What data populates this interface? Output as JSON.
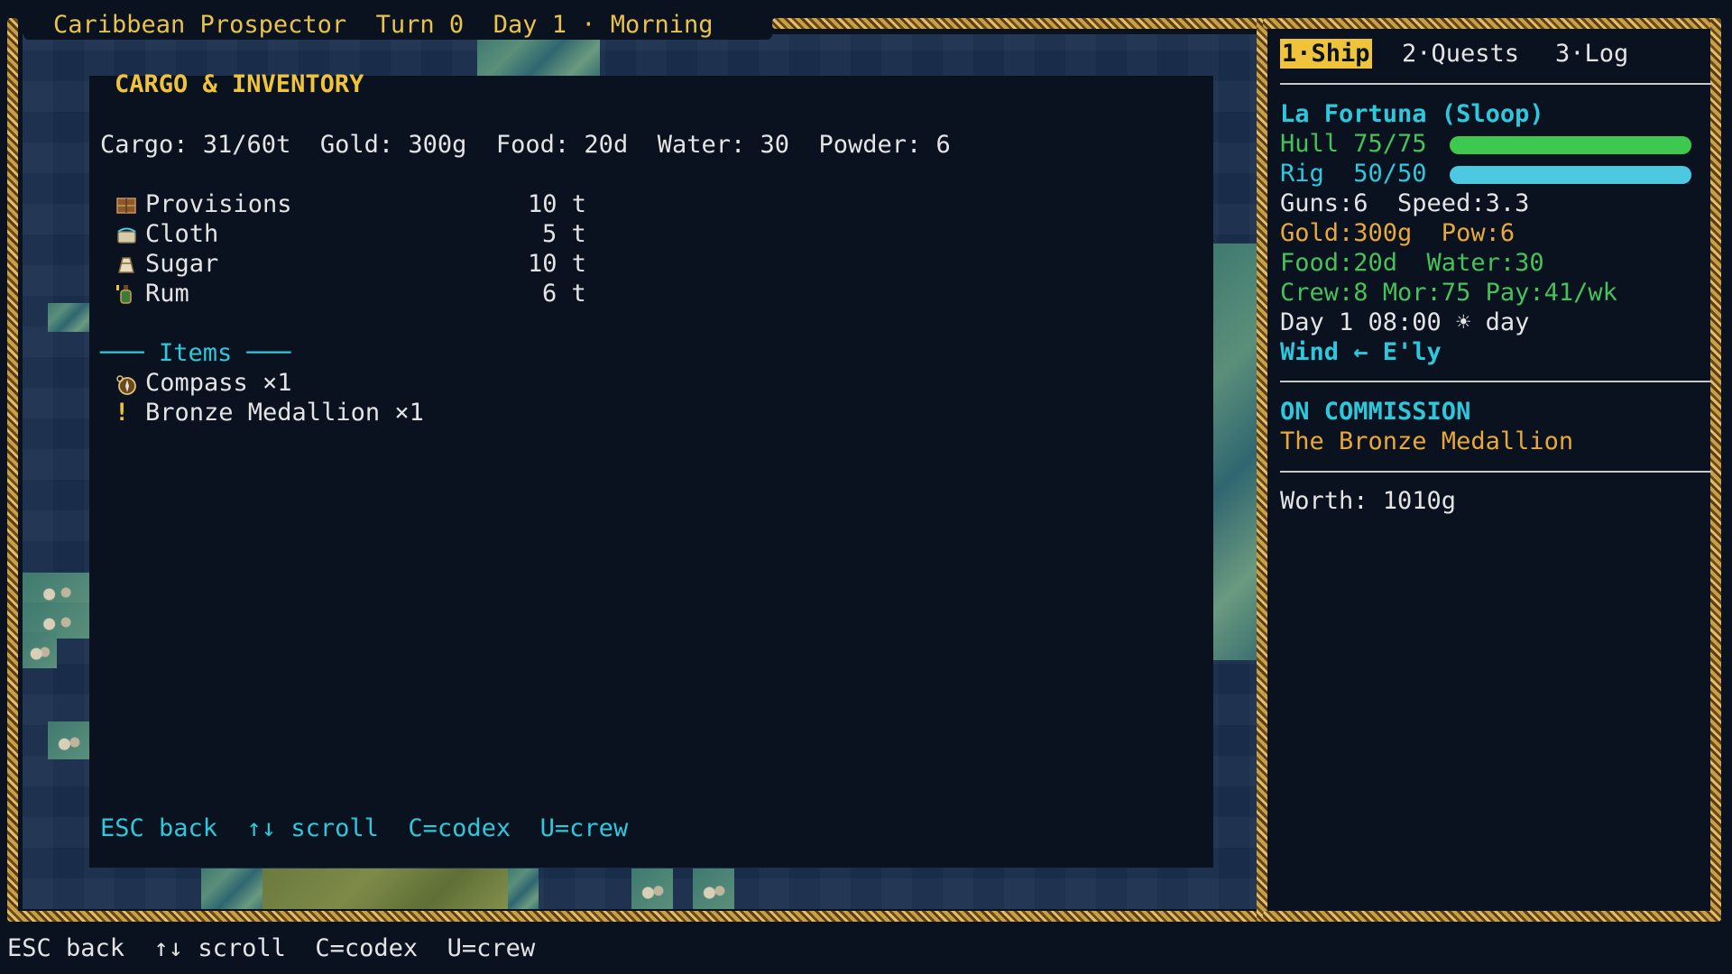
{
  "titlebar": {
    "game_title": "Caribbean Prospector",
    "turn": "Turn 0",
    "day": "Day 1 · Morning"
  },
  "cargo_panel": {
    "heading": "CARGO & INVENTORY",
    "summary": "Cargo: 31/60t  Gold: 300g  Food: 20d  Water: 30  Powder: 6",
    "goods": [
      {
        "name": "Provisions",
        "qty": "10 t",
        "icon": "crate-icon"
      },
      {
        "name": "Cloth",
        "qty": "5 t",
        "icon": "cloth-icon"
      },
      {
        "name": "Sugar",
        "qty": "10 t",
        "icon": "sugar-icon"
      },
      {
        "name": "Rum",
        "qty": "6 t",
        "icon": "rum-bottle-icon"
      }
    ],
    "items_header": "─── Items ───",
    "items": [
      {
        "name": "Compass ×1",
        "icon": "compass-icon"
      },
      {
        "name": "Bronze Medallion ×1",
        "icon": "exclamation-icon",
        "glyph": "!"
      }
    ],
    "help": "ESC back  ↑↓ scroll  C=codex  U=crew"
  },
  "side": {
    "tabs": [
      {
        "label": "1·Ship",
        "active": true
      },
      {
        "label": "2·Quests",
        "active": false
      },
      {
        "label": "3·Log",
        "active": false
      }
    ],
    "ship_name": "La Fortuna (Sloop)",
    "hull_label": "Hull 75/75",
    "hull_value": 75,
    "hull_max": 75,
    "rig_label": "Rig  50/50",
    "rig_value": 50,
    "rig_max": 50,
    "guns_speed": "Guns:6  Speed:3.3",
    "gold_pow": "Gold:300g  Pow:6",
    "food_water": "Food:20d  Water:30",
    "crew": "Crew:8 Mor:75 Pay:41/wk",
    "time": "Day 1 08:00 ☀ day",
    "wind": "Wind ← E'ly",
    "commission_header": "ON COMMISSION",
    "commission_name": "The Bronze Medallion",
    "worth": "Worth: 1010g"
  },
  "bottom_help": "ESC back  ↑↓ scroll  C=codex  U=crew",
  "colors": {
    "accent_yellow": "#f0c43a",
    "cyan": "#2ec8dc",
    "green": "#47c25a",
    "hull_bar": "#3ec850",
    "rig_bar": "#4cc8e0"
  }
}
